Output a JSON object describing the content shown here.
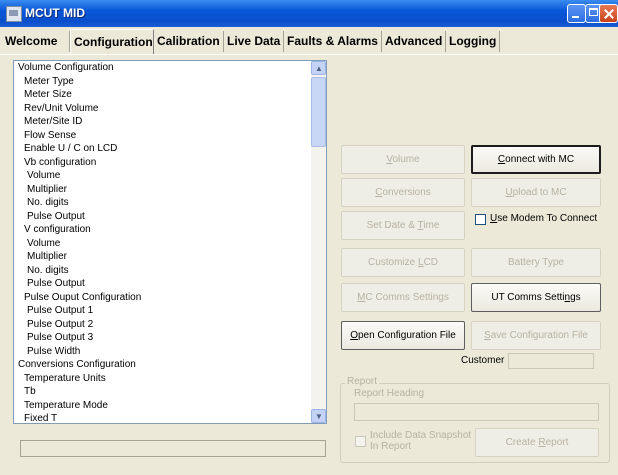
{
  "window": {
    "title": "MCUT MID"
  },
  "tabs": [
    "Welcome",
    "Configuration",
    "Calibration",
    "Live Data",
    "Faults & Alarms",
    "Advanced",
    "Logging"
  ],
  "active_tab": "Configuration",
  "config_list": {
    "items": [
      {
        "label": "Volume Configuration",
        "level": 0
      },
      {
        "label": "Meter Type",
        "level": 1
      },
      {
        "label": "Meter Size",
        "level": 1
      },
      {
        "label": "Rev/Unit Volume",
        "level": 1
      },
      {
        "label": "Meter/Site ID",
        "level": 1
      },
      {
        "label": "Flow Sense",
        "level": 1
      },
      {
        "label": "Enable U / C on LCD",
        "level": 1
      },
      {
        "label": "Vb configuration",
        "level": 1
      },
      {
        "label": "Volume",
        "level": 2
      },
      {
        "label": "Multiplier",
        "level": 2
      },
      {
        "label": "No. digits",
        "level": 2
      },
      {
        "label": "Pulse Output",
        "level": 2
      },
      {
        "label": "V configuration",
        "level": 1
      },
      {
        "label": "Volume",
        "level": 2
      },
      {
        "label": "Multiplier",
        "level": 2
      },
      {
        "label": "No. digits",
        "level": 2
      },
      {
        "label": "Pulse Output",
        "level": 2
      },
      {
        "label": "Pulse Ouput Configuration",
        "level": 1
      },
      {
        "label": "Pulse Output 1",
        "level": 2
      },
      {
        "label": "Pulse Output 2",
        "level": 2
      },
      {
        "label": "Pulse Output 3",
        "level": 2
      },
      {
        "label": "Pulse Width",
        "level": 2
      },
      {
        "label": "Conversions Configuration",
        "level": 0
      },
      {
        "label": "Temperature Units",
        "level": 1
      },
      {
        "label": "Tb",
        "level": 1
      },
      {
        "label": "Temperature Mode",
        "level": 1
      },
      {
        "label": "Fixed T",
        "level": 1
      }
    ]
  },
  "buttons": {
    "volume": {
      "pre": "",
      "u": "V",
      "post": "olume"
    },
    "connect": {
      "pre": "",
      "u": "C",
      "post": "onnect with MC"
    },
    "conversions": {
      "pre": "",
      "u": "C",
      "post": "onversions"
    },
    "upload": {
      "pre": "",
      "u": "U",
      "post": "pload to MC"
    },
    "set_date": {
      "pre": "Set Date & ",
      "u": "T",
      "post": "ime"
    },
    "customize_lcd": {
      "pre": "Customize ",
      "u": "L",
      "post": "CD"
    },
    "battery_type": {
      "pre": "Battery Type",
      "u": "",
      "post": ""
    },
    "mc_comms": {
      "pre": "",
      "u": "M",
      "post": "C Comms Settings"
    },
    "ut_comms": {
      "pre": "UT Comms Setti",
      "u": "n",
      "post": "gs"
    },
    "open_config": {
      "pre": "",
      "u": "O",
      "post": "pen Configuration File"
    },
    "save_config": {
      "pre": "",
      "u": "S",
      "post": "ave Configuration File"
    },
    "create_report": {
      "pre": "Create ",
      "u": "R",
      "post": "eport"
    }
  },
  "use_modem": {
    "pre": "",
    "u": "U",
    "post": "se Modem To Connect",
    "checked": false
  },
  "customer": {
    "label": "Customer",
    "value": ""
  },
  "report": {
    "group_title": "Report",
    "heading_label": "Report Heading",
    "heading_value": "",
    "snapshot_line1": "Include Data Snapshot",
    "snapshot_line2": "In Report",
    "snapshot_checked": false
  }
}
